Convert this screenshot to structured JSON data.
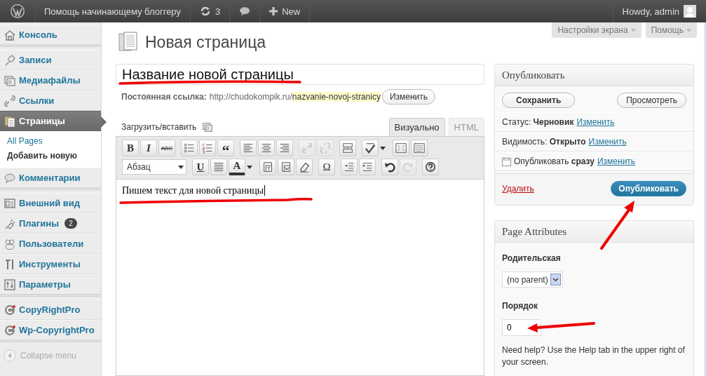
{
  "admin_bar": {
    "site_name": "Помощь начинающему блоггеру",
    "updates_count": "3",
    "new_label": "New",
    "greeting": "Howdy, admin"
  },
  "sidebar": {
    "groups": [
      [
        {
          "label": "Консоль",
          "kind": "home",
          "selected": false
        }
      ],
      [
        {
          "label": "Записи",
          "kind": "pin",
          "selected": false
        },
        {
          "label": "Медиафайлы",
          "kind": "media",
          "selected": false
        },
        {
          "label": "Ссылки",
          "kind": "link",
          "selected": false
        },
        {
          "label": "Страницы",
          "kind": "pages",
          "selected": true,
          "children": [
            {
              "label": "All Pages",
              "selected": false
            },
            {
              "label": "Добавить новую",
              "selected": true
            }
          ]
        },
        {
          "label": "Комментарии",
          "kind": "comments",
          "selected": false
        }
      ],
      [
        {
          "label": "Внешний вид",
          "kind": "appearance",
          "selected": false
        },
        {
          "label": "Плагины",
          "kind": "plugins",
          "selected": false,
          "badge": "2"
        },
        {
          "label": "Пользователи",
          "kind": "users",
          "selected": false
        },
        {
          "label": "Инструменты",
          "kind": "tools",
          "selected": false
        },
        {
          "label": "Параметры",
          "kind": "settings",
          "selected": false
        }
      ],
      [
        {
          "label": "CopyRightPro",
          "kind": "copyright",
          "selected": false
        },
        {
          "label": "Wp-CopyrightPro",
          "kind": "copyright",
          "selected": false
        }
      ]
    ],
    "collapse_label": "Collapse menu"
  },
  "screen_tabs": [
    "Настройки экрана",
    "Помощь"
  ],
  "page_title": "Новая страница",
  "title_field": {
    "value": "Название новой страницы"
  },
  "permalink": {
    "label": "Постоянная ссылка:",
    "base": "http://chudokompik.ru/",
    "slug": "nazvanie-novoj-stranicy",
    "button": "Изменить"
  },
  "upload_label": "Загрузить/вставить",
  "editor_tabs": [
    {
      "label": "Визуально",
      "selected": true
    },
    {
      "label": "HTML",
      "selected": false
    }
  ],
  "toolbar_rows": [
    [
      {
        "kind": "glyph",
        "text": "B",
        "disabled": false
      },
      {
        "kind": "glyph",
        "text": "I",
        "disabled": false
      },
      {
        "kind": "glyph",
        "text": "ABC",
        "disabled": false
      },
      {
        "kind": "bullets",
        "disabled": false
      },
      {
        "kind": "numbers",
        "disabled": false
      },
      {
        "kind": "glyph",
        "text": "“",
        "disabled": false
      },
      {
        "kind": "align-left",
        "disabled": false
      },
      {
        "kind": "align-center",
        "disabled": false
      },
      {
        "kind": "align-right",
        "disabled": false
      },
      {
        "kind": "link",
        "disabled": true
      },
      {
        "kind": "unlink",
        "disabled": true
      },
      {
        "kind": "more",
        "disabled": false
      },
      {
        "kind": "spellcheck",
        "disabled": false
      },
      {
        "kind": "fullscreen",
        "disabled": false
      },
      {
        "kind": "keyboard",
        "disabled": false
      }
    ],
    [
      {
        "kind": "format",
        "text": "Абзац",
        "disabled": false
      },
      {
        "kind": "glyph",
        "text": "U",
        "disabled": false
      },
      {
        "kind": "justify",
        "disabled": false
      },
      {
        "kind": "color",
        "text": "A",
        "disabled": false
      },
      {
        "kind": "paste-text",
        "disabled": false
      },
      {
        "kind": "paste-word",
        "disabled": false
      },
      {
        "kind": "eraser",
        "disabled": false
      },
      {
        "kind": "glyph",
        "text": "Ω",
        "disabled": false
      },
      {
        "kind": "outdent",
        "disabled": false
      },
      {
        "kind": "indent",
        "disabled": false
      },
      {
        "kind": "undo",
        "disabled": false
      },
      {
        "kind": "redo",
        "disabled": true
      },
      {
        "kind": "help",
        "disabled": false
      }
    ]
  ],
  "content": "Пишем текст для новой страницы",
  "publish_box": {
    "title": "Опубликовать",
    "save_button": "Сохранить",
    "preview_button": "Просмотреть",
    "rows": [
      {
        "kind": "status",
        "text": "Статус: **Черновик**",
        "link": "Изменить"
      },
      {
        "kind": "visibility",
        "text": "Видимость: **Открыто**",
        "link": "Изменить"
      },
      {
        "kind": "schedule",
        "text": "Опубликовать **сразу**",
        "link": "Изменить"
      }
    ],
    "delete_link": "Удалить",
    "publish_button": "Опубликовать"
  },
  "page_attributes": {
    "title": "Page Attributes",
    "parent_label": "Родительская",
    "parent_value": "(no parent)",
    "order_label": "Порядок",
    "order_value": "0",
    "help": "Need help? Use the Help tab in the upper right of your screen."
  }
}
